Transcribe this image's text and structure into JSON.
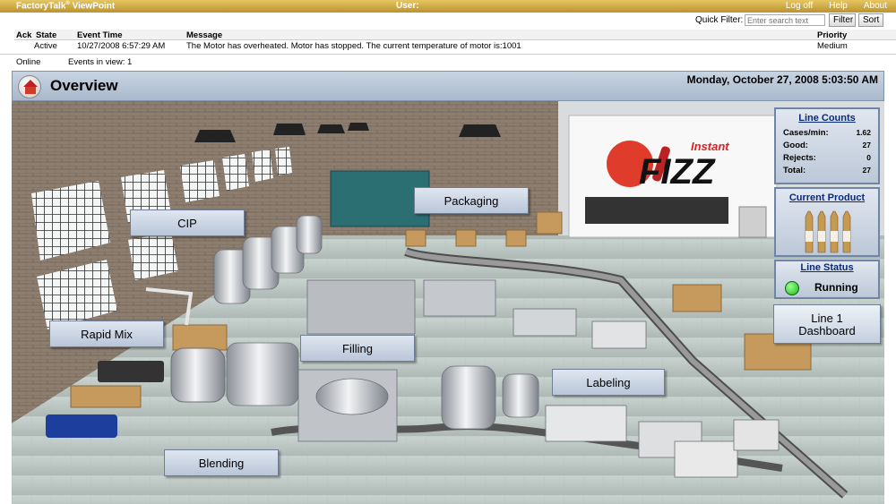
{
  "topbar": {
    "title": "FactoryTalk",
    "title_mark": "®",
    "title_suffix": " ViewPoint",
    "user_label": "User:",
    "links": [
      "Log off",
      "Help",
      "About"
    ]
  },
  "filter": {
    "label": "Quick Filter:",
    "placeholder": "Enter search text",
    "filter_button": "Filter",
    "sort_button": "Sort"
  },
  "alarms": {
    "columns": [
      "Ack",
      "State",
      "Event Time",
      "Message",
      "Priority"
    ],
    "rows": [
      {
        "ack": "",
        "state": "Active",
        "time": "10/27/2008 6:57:29 AM",
        "message": "The Motor has overheated. Motor has stopped. The current temperature of motor is:1001",
        "priority": "Medium"
      }
    ]
  },
  "status": {
    "online": "Online",
    "events": "Events in view: 1"
  },
  "overview": {
    "title": "Overview",
    "datetime": "Monday, October 27, 2008   5:03:50 AM"
  },
  "areas": {
    "cip": "CIP",
    "packaging": "Packaging",
    "rapid_mix": "Rapid Mix",
    "filling": "Filling",
    "labeling": "Labeling",
    "blending": "Blending"
  },
  "brand": {
    "small": "Instant",
    "big": "FIZZ"
  },
  "line_counts": {
    "title": "Line Counts",
    "rows": [
      {
        "label": "Cases/min:",
        "value": "1.62"
      },
      {
        "label": "Good:",
        "value": "27"
      },
      {
        "label": "Rejects:",
        "value": "0"
      },
      {
        "label": "Total:",
        "value": "27"
      }
    ]
  },
  "current_product": {
    "title": "Current Product"
  },
  "line_status": {
    "title": "Line Status",
    "value": "Running"
  },
  "dashboard_button": {
    "line1": "Line 1",
    "line2": "Dashboard"
  },
  "colors": {
    "accent_gold": "#c9a23e",
    "panel_border": "#6f85a6",
    "running_green": "#1db818"
  }
}
